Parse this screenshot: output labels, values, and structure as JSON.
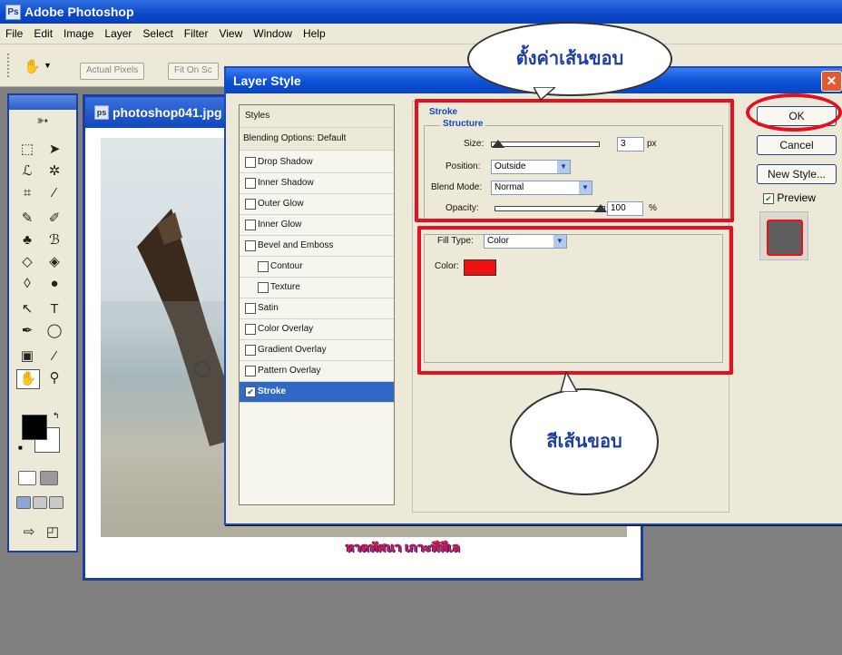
{
  "app": {
    "title": "Adobe Photoshop",
    "icon": "photoshop-icon"
  },
  "menu": [
    "File",
    "Edit",
    "Image",
    "Layer",
    "Select",
    "Filter",
    "View",
    "Window",
    "Help"
  ],
  "options_bar": {
    "actual_pixels": "Actual Pixels",
    "fit_on_screen": "Fit On Sc"
  },
  "document": {
    "title": "photoshop041.jpg",
    "caption": "หาดทัศนา เกาะพีพีเล"
  },
  "dialog": {
    "title": "Layer Style",
    "styles_header": "Styles",
    "blending_options": "Blending Options: Default",
    "effects": [
      {
        "label": "Drop Shadow",
        "checked": false
      },
      {
        "label": "Inner Shadow",
        "checked": false
      },
      {
        "label": "Outer Glow",
        "checked": false
      },
      {
        "label": "Inner Glow",
        "checked": false
      },
      {
        "label": "Bevel and Emboss",
        "checked": false
      },
      {
        "label": "Contour",
        "checked": false
      },
      {
        "label": "Texture",
        "checked": false
      },
      {
        "label": "Satin",
        "checked": false
      },
      {
        "label": "Color Overlay",
        "checked": false
      },
      {
        "label": "Gradient Overlay",
        "checked": false
      },
      {
        "label": "Pattern Overlay",
        "checked": false
      },
      {
        "label": "Stroke",
        "checked": true,
        "selected": true
      }
    ],
    "stroke": {
      "section_title": "Stroke",
      "structure_title": "Structure",
      "size_label": "Size:",
      "size_value": "3",
      "size_unit": "px",
      "position_label": "Position:",
      "position_value": "Outside",
      "blend_mode_label": "Blend Mode:",
      "blend_mode_value": "Normal",
      "opacity_label": "Opacity:",
      "opacity_value": "100",
      "opacity_unit": "%",
      "fill_type_label": "Fill Type:",
      "fill_type_value": "Color",
      "color_label": "Color:",
      "color_value": "#ee1111"
    },
    "buttons": {
      "ok": "OK",
      "cancel": "Cancel",
      "new_style": "New Style...",
      "preview": "Preview"
    },
    "preview_checked": true
  },
  "annotations": {
    "bubble_top": "ตั้งค่าเส้นขอบ",
    "bubble_bottom": "สีเส้นขอบ",
    "highlight_color": "#e5101f"
  }
}
